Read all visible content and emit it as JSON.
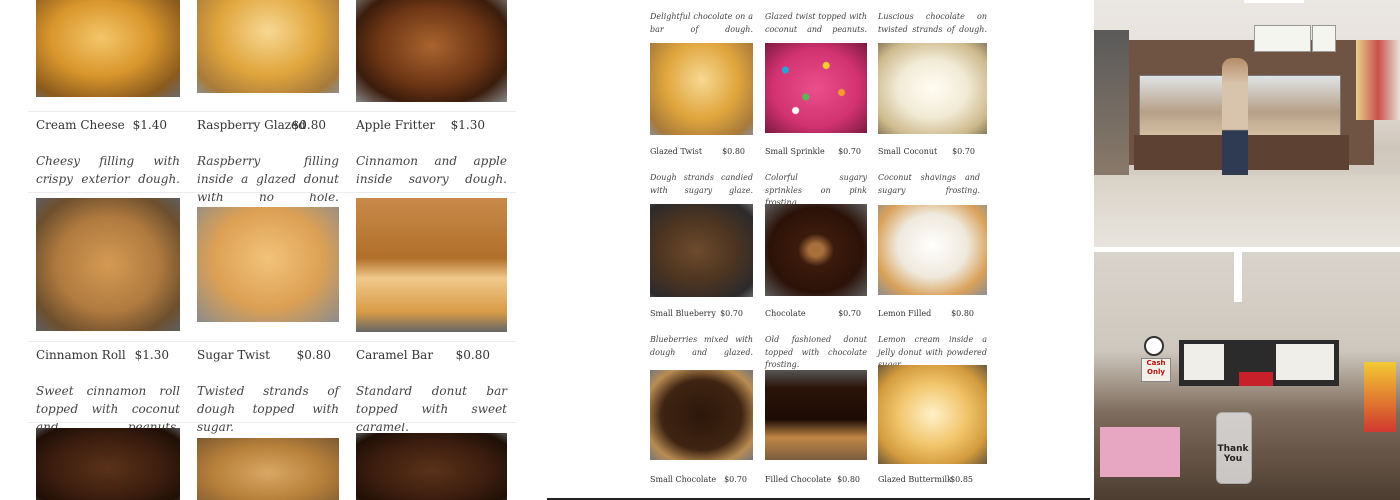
{
  "left": {
    "items": [
      {
        "name": "Cream Cheese",
        "price": "$1.40",
        "desc": "Cheesy filling with crispy exterior dough."
      },
      {
        "name": "Raspberry Glazed",
        "price": "$0.80",
        "desc": "Raspberry filling inside a glazed donut with no hole."
      },
      {
        "name": "Apple Fritter",
        "price": "$1.30",
        "desc": "Cinnamon and apple inside savory dough."
      },
      {
        "name": "Cinnamon Roll",
        "price": "$1.30",
        "desc": "Sweet cinnamon roll topped with coconut and peanuts."
      },
      {
        "name": "Sugar Twist",
        "price": "$0.80",
        "desc": "Twisted strands of dough topped with sugar."
      },
      {
        "name": "Caramel Bar",
        "price": "$0.80",
        "desc": "Standard donut bar topped with sweet caramel."
      }
    ]
  },
  "mid": {
    "top_descs": [
      "Delightful chocolate on a bar of dough.",
      "Glazed twist topped with coconut and peanuts.",
      "Luscious chocolate on twisted strands of dough."
    ],
    "items": [
      {
        "name": "Glazed Twist",
        "price": "$0.80",
        "desc": "Dough strands candied with sugary glaze."
      },
      {
        "name": "Small Sprinkle",
        "price": "$0.70",
        "desc": "Colorful sugary sprinkles on pink frosting."
      },
      {
        "name": "Small Coconut",
        "price": "$0.70",
        "desc": "Coconut shavings and sugary frosting."
      },
      {
        "name": "Small Blueberry",
        "price": "$0.70",
        "desc": "Blueberries mixed with dough and glazed."
      },
      {
        "name": "Chocolate",
        "price": "$0.70",
        "desc": "Old fashioned donut topped with chocolate frosting."
      },
      {
        "name": "Lemon Filled",
        "price": "$0.80",
        "desc": "Lemon cream inside a jelly donut with powdered sugar."
      },
      {
        "name": "Small Chocolate",
        "price": "$0.70"
      },
      {
        "name": "Filled Chocolate",
        "price": "$0.80"
      },
      {
        "name": "Glazed Buttermilk",
        "price": "$0.85"
      }
    ]
  },
  "right": {
    "cash_sign": "Cash Only",
    "jar_label": "Thank You"
  }
}
